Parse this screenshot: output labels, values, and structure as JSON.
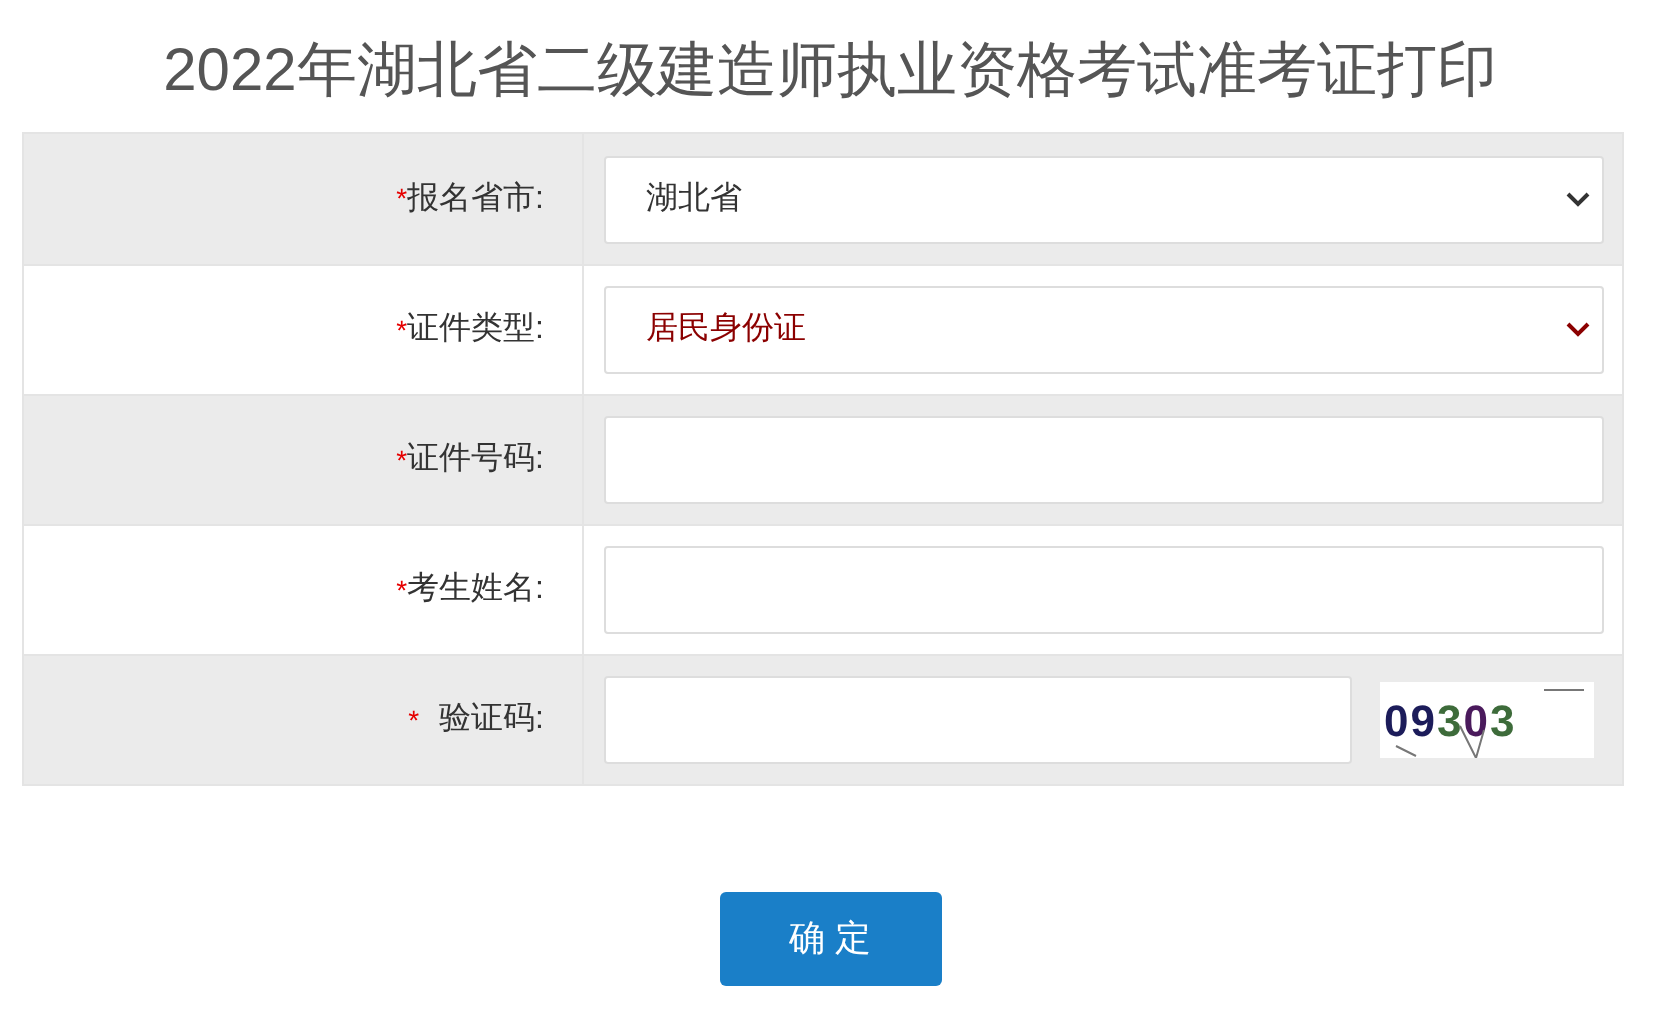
{
  "title": "2022年湖北省二级建造师执业资格考试准考证打印",
  "rows": [
    {
      "kind": "select",
      "marker": "*",
      "label": "报名省市:",
      "value": "湖北省",
      "highlight": false
    },
    {
      "kind": "select",
      "marker": "*",
      "label": "证件类型:",
      "value": "居民身份证",
      "highlight": true
    },
    {
      "kind": "input",
      "marker": "*",
      "label": "证件号码:"
    },
    {
      "kind": "input",
      "marker": "*",
      "label": "考生姓名:"
    },
    {
      "kind": "captcha",
      "marker": "*",
      "label": "验证码:",
      "captcha": "09303"
    }
  ],
  "submit": "确 定"
}
